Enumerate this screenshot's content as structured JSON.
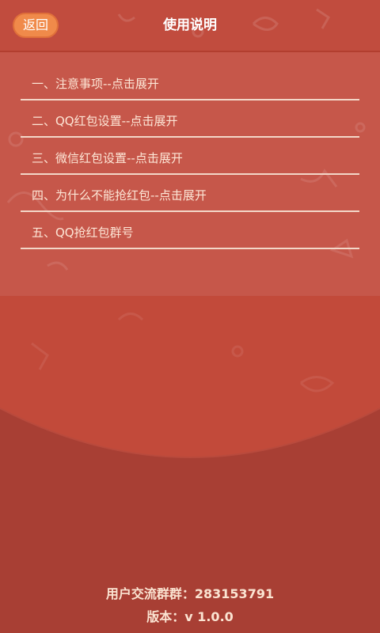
{
  "header": {
    "back_label": "返回",
    "title": "使用说明"
  },
  "menu": {
    "items": [
      {
        "label": "一、注意事项--点击展开"
      },
      {
        "label": "二、QQ红包设置--点击展开"
      },
      {
        "label": "三、微信红包设置--点击展开"
      },
      {
        "label": "四、为什么不能抢红包--点击展开"
      },
      {
        "label": "五、QQ抢红包群号"
      }
    ]
  },
  "footer": {
    "group_text": "用户交流群群：283153791",
    "version_text": "版本：v 1.0.0"
  },
  "colors": {
    "background": "#c24a3a",
    "upper_panel": "#c6574a",
    "flap": "#a83f34",
    "back_button": "#f08a4a",
    "menu_text": "#fde6d6",
    "divider": "#f3d7c8"
  }
}
